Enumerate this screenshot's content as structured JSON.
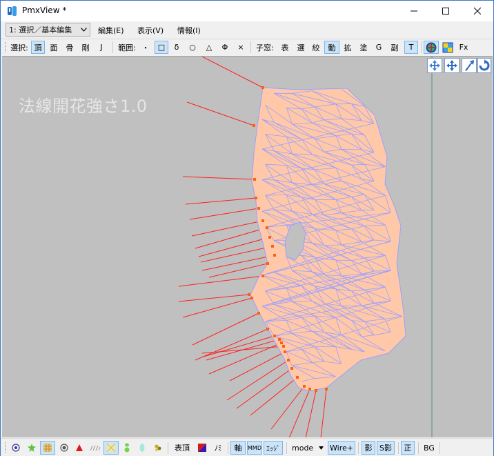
{
  "window": {
    "title": "PmxView *"
  },
  "menubar": {
    "mode_selected": "1: 選択／基本編集",
    "items": [
      "編集(E)",
      "表示(V)",
      "情報(I)"
    ]
  },
  "toolbar": {
    "select_label": "選択:",
    "select_items": [
      "頂",
      "面",
      "骨",
      "剛",
      "J"
    ],
    "range_label": "範囲:",
    "range_items": [
      "・",
      "□",
      "δ",
      "○",
      "△",
      "Φ",
      "×"
    ],
    "child_label": "子窓:",
    "child_items": [
      "表",
      "選",
      "絞",
      "動",
      "拡",
      "塗",
      "G",
      "副",
      "T"
    ],
    "fx_label": "Fx"
  },
  "viewport": {
    "overlay_text": "法線開花強さ1.0",
    "background": "#c0c0c0",
    "mesh_fill": "#ffc8a8",
    "mesh_edge": "#9aa0ff",
    "normal_color": "#ff2020",
    "vertex_color": "#ff6010"
  },
  "bottombar": {
    "vertex_label": "表頂",
    "mi_label": "ﾉﾐ",
    "axis_label": "軸",
    "mmd_label": "MMD",
    "edge_label": "ｴｯｼﾞ",
    "mode_label": "mode",
    "wire_label": "Wire+",
    "shadow_label": "影",
    "sshadow_label": "S影",
    "sei_label": "正",
    "bg_label": "BG"
  },
  "icons": {
    "app": "pmx-app-icon",
    "minimize": "minimize-icon",
    "maximize": "maximize-icon",
    "close": "close-icon"
  }
}
